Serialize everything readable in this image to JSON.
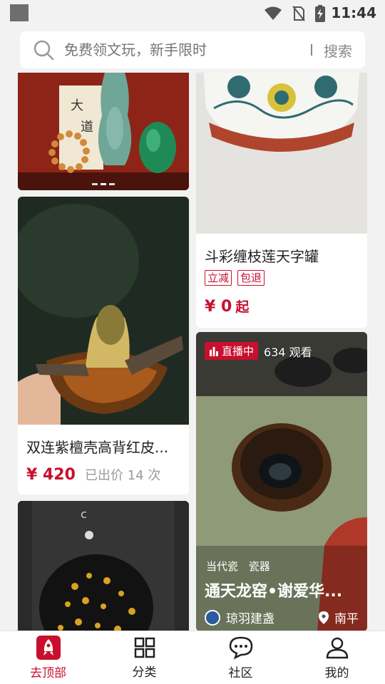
{
  "status_bar": {
    "time": "11:44"
  },
  "search": {
    "placeholder": "免费领文玩，新手限时",
    "button_label": "搜索"
  },
  "cards": [
    {
      "id": "jade-vase",
      "title": ""
    },
    {
      "id": "doucai-jar",
      "title": "斗彩缠枝莲天字罐",
      "tags": [
        "立减",
        "包退"
      ],
      "price": "¥ 0",
      "price_suffix": "起"
    },
    {
      "id": "turtle-1",
      "title": "双连紫檀壳高背红皮...",
      "price": "¥ 420",
      "price_note": "已出价 14 次"
    },
    {
      "id": "live-tea-bowl",
      "live_label": "直播中",
      "viewers": "634 观看",
      "categories": [
        "当代瓷",
        "瓷器"
      ],
      "title": "通天龙窑•谢爱华...",
      "shop": "琼羽建盏",
      "location": "南平"
    },
    {
      "id": "turtle-2",
      "title": ""
    }
  ],
  "bottom_nav": [
    {
      "label": "去顶部",
      "icon": "rocket-icon",
      "active": true
    },
    {
      "label": "分类",
      "icon": "grid-icon",
      "active": false
    },
    {
      "label": "社区",
      "icon": "chat-bubble-icon",
      "active": false
    },
    {
      "label": "我的",
      "icon": "user-icon",
      "active": false
    }
  ],
  "colors": {
    "accent": "#c8102e",
    "background": "#f2f2f2"
  }
}
